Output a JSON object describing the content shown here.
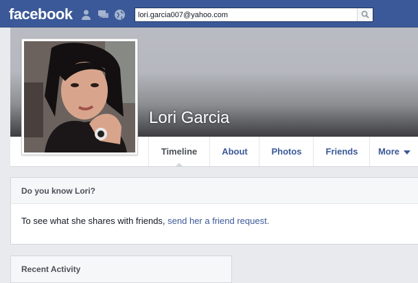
{
  "header": {
    "logo": "facebook",
    "search": {
      "value": "lori.garcia007@yahoo.com",
      "placeholder": ""
    },
    "icons": [
      "friend-requests-icon",
      "messages-icon",
      "notifications-globe-icon",
      "search-icon"
    ]
  },
  "profile": {
    "name": "Lori Garcia"
  },
  "nav": {
    "tabs": [
      {
        "label": "Timeline",
        "active": true
      },
      {
        "label": "About"
      },
      {
        "label": "Photos"
      },
      {
        "label": "Friends"
      },
      {
        "label": "More"
      }
    ]
  },
  "know": {
    "title": "Do you know Lori?",
    "text": "To see what she shares with friends, ",
    "link": "send her a friend request."
  },
  "recent": {
    "title": "Recent Activity"
  },
  "colors": {
    "brand": "#3b5998",
    "background": "#e9eaed"
  }
}
